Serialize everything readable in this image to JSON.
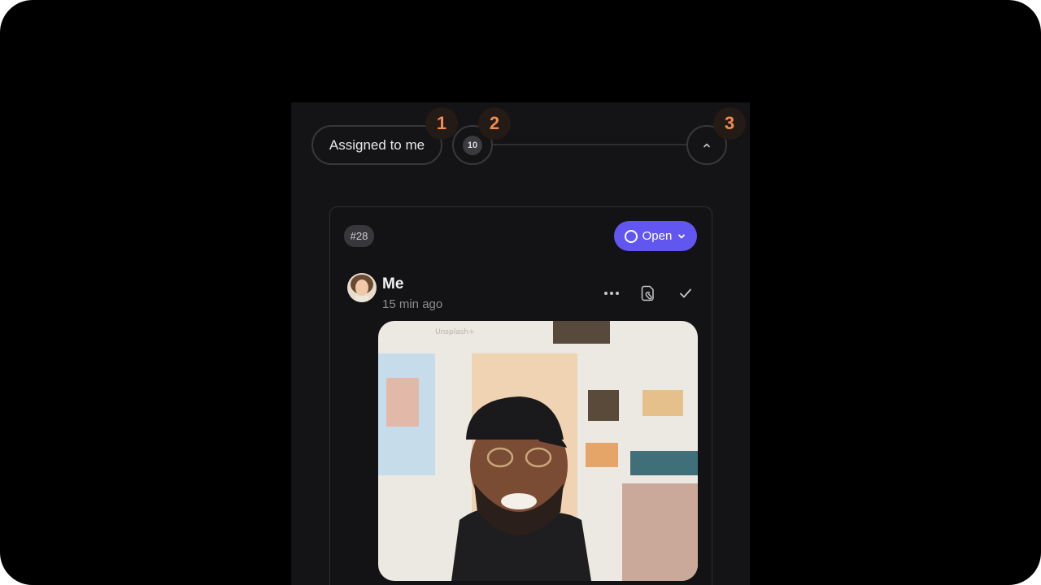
{
  "filter": {
    "assigned_label": "Assigned to me",
    "count": "10"
  },
  "markers": [
    "1",
    "2",
    "3"
  ],
  "card": {
    "issue_id": "#28",
    "status_label": "Open",
    "author": "Me",
    "time": "15 min ago",
    "photo_watermark": "Unsplash+"
  },
  "icons": [
    "chevron-up-icon",
    "chevron-down-icon",
    "more-icon",
    "attach-icon",
    "check-icon"
  ],
  "colors": {
    "background": "#000000",
    "panel": "#141416",
    "accent": "#6157f0",
    "marker": "#f08c4e"
  }
}
